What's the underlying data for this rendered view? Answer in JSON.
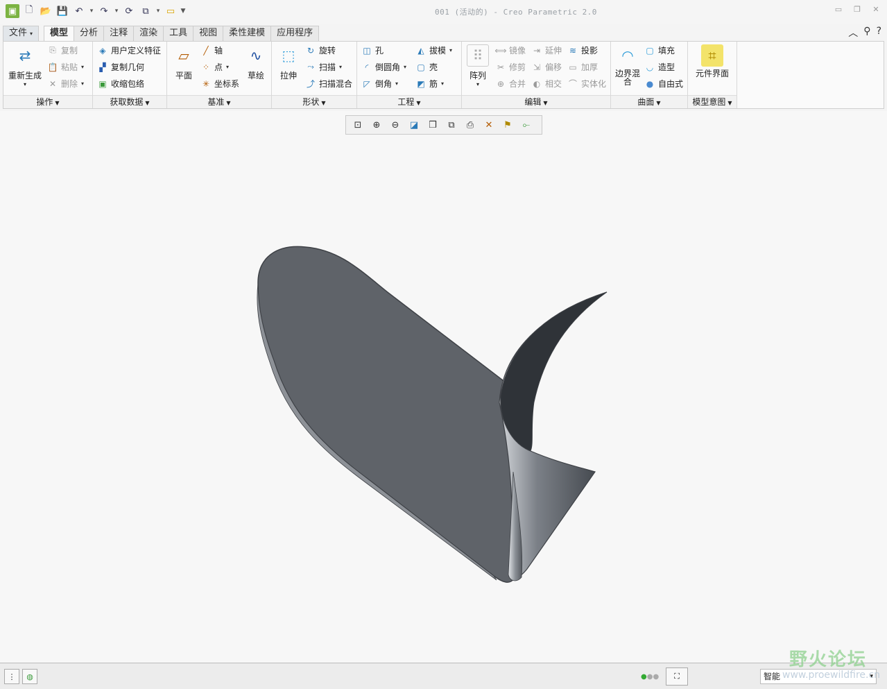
{
  "window": {
    "title": "001 (活动的) - Creo Parametric 2.0"
  },
  "tabs": [
    "文件",
    "模型",
    "分析",
    "注释",
    "渲染",
    "工具",
    "视图",
    "柔性建模",
    "应用程序"
  ],
  "ribbon": {
    "operations": {
      "label": "操作",
      "regenerate": "重新生成",
      "copy": "复制",
      "paste": "粘贴",
      "delete": "删除"
    },
    "get_data": {
      "label": "获取数据",
      "udf": "用户定义特征",
      "copy_geom": "复制几何",
      "shrinkwrap": "收缩包络"
    },
    "datum": {
      "label": "基准",
      "plane": "平面",
      "axis": "轴",
      "point": "点",
      "csys": "坐标系",
      "sketch": "草绘"
    },
    "shapes": {
      "label": "形状",
      "extrude": "拉伸",
      "revolve": "旋转",
      "sweep": "扫描",
      "swept_blend": "扫描混合"
    },
    "engineering": {
      "label": "工程",
      "hole": "孔",
      "round": "倒圆角",
      "chamfer": "倒角",
      "draft": "拔模",
      "shell": "壳",
      "rib": "筋"
    },
    "editing": {
      "label": "编辑",
      "pattern": "阵列",
      "mirror": "镜像",
      "trim": "修剪",
      "merge": "合并",
      "extend": "延伸",
      "offset": "偏移",
      "intersect": "相交",
      "project": "投影",
      "thicken": "加厚",
      "solidify": "实体化"
    },
    "surfaces": {
      "label": "曲面",
      "boundary_blend": "边界混合",
      "fill": "填充",
      "style": "造型",
      "freestyle": "自由式"
    },
    "model_intent": {
      "label": "模型意图",
      "component_interface": "元件界面"
    }
  },
  "statusbar": {
    "filter": "智能"
  },
  "watermark": {
    "brand": "野火论坛",
    "url": "www.proewildfire.cn"
  },
  "colors": {
    "part": "#5f6369",
    "part_edge": "#3e4146",
    "background": "#f7f7f7"
  }
}
